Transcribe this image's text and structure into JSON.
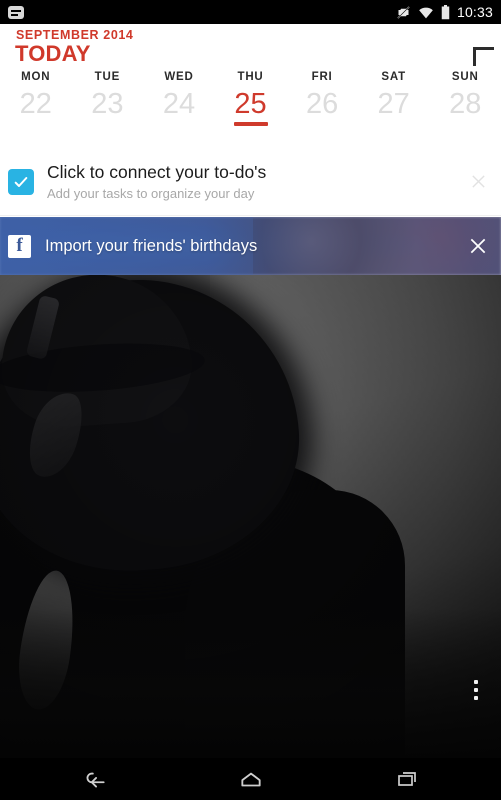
{
  "statusbar": {
    "notification_icon": "app-badge-icon",
    "mute_icon": "vibrate-off-icon",
    "wifi_icon": "wifi-icon",
    "battery_icon": "battery-icon",
    "time": "10:33"
  },
  "header": {
    "month": "SEPTEMBER 2014",
    "title": "TODAY",
    "add_icon": "plus-icon"
  },
  "week": {
    "days": [
      {
        "name": "MON",
        "date": "22",
        "active": false
      },
      {
        "name": "TUE",
        "date": "23",
        "active": false
      },
      {
        "name": "WED",
        "date": "24",
        "active": false
      },
      {
        "name": "THU",
        "date": "25",
        "active": true
      },
      {
        "name": "FRI",
        "date": "26",
        "active": false
      },
      {
        "name": "SAT",
        "date": "27",
        "active": false
      },
      {
        "name": "SUN",
        "date": "28",
        "active": false
      }
    ],
    "accent_color": "#cf3a2c"
  },
  "todo_banner": {
    "icon": "checkbox-checked-icon",
    "icon_color": "#29b3e3",
    "title": "Click to connect your to-do's",
    "subtitle": "Add your tasks to organize your day",
    "close_icon": "close-icon"
  },
  "facebook_banner": {
    "icon": "facebook-icon",
    "icon_letter": "f",
    "label": "Import your friends' birthdays",
    "close_icon": "close-icon",
    "brand_color": "#3b5998"
  },
  "photo": {
    "overflow_icon": "overflow-menu-icon",
    "description": "person in wide-brimmed black hat"
  },
  "navbar": {
    "back_icon": "back-icon",
    "home_icon": "home-icon",
    "recents_icon": "recents-icon"
  }
}
